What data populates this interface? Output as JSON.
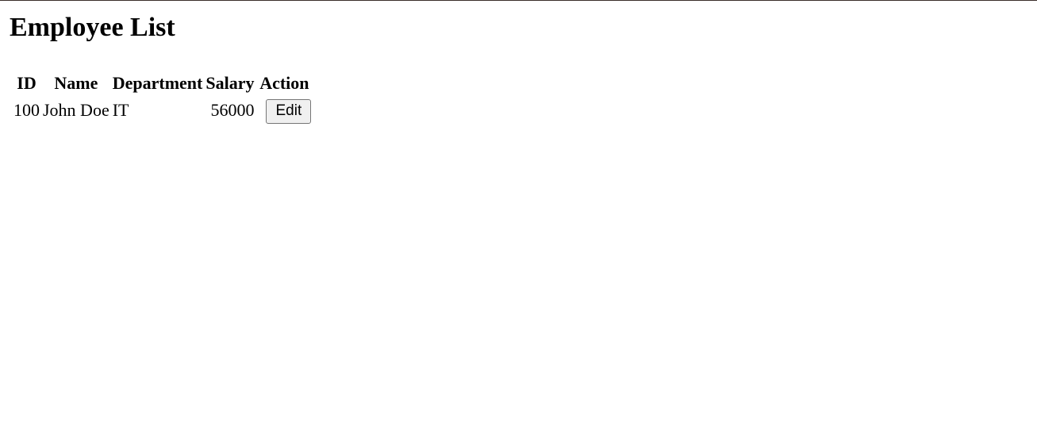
{
  "page": {
    "title": "Employee List"
  },
  "table": {
    "headers": [
      "ID",
      "Name",
      "Department",
      "Salary",
      "Action"
    ],
    "rows": [
      {
        "id": "100",
        "name": "John Doe",
        "department": "IT",
        "salary": "56000",
        "action_label": "Edit"
      }
    ]
  },
  "colors": {
    "top_border": "#3a2e2a",
    "button_bg": "#f0f0f0",
    "button_border": "#767676"
  }
}
